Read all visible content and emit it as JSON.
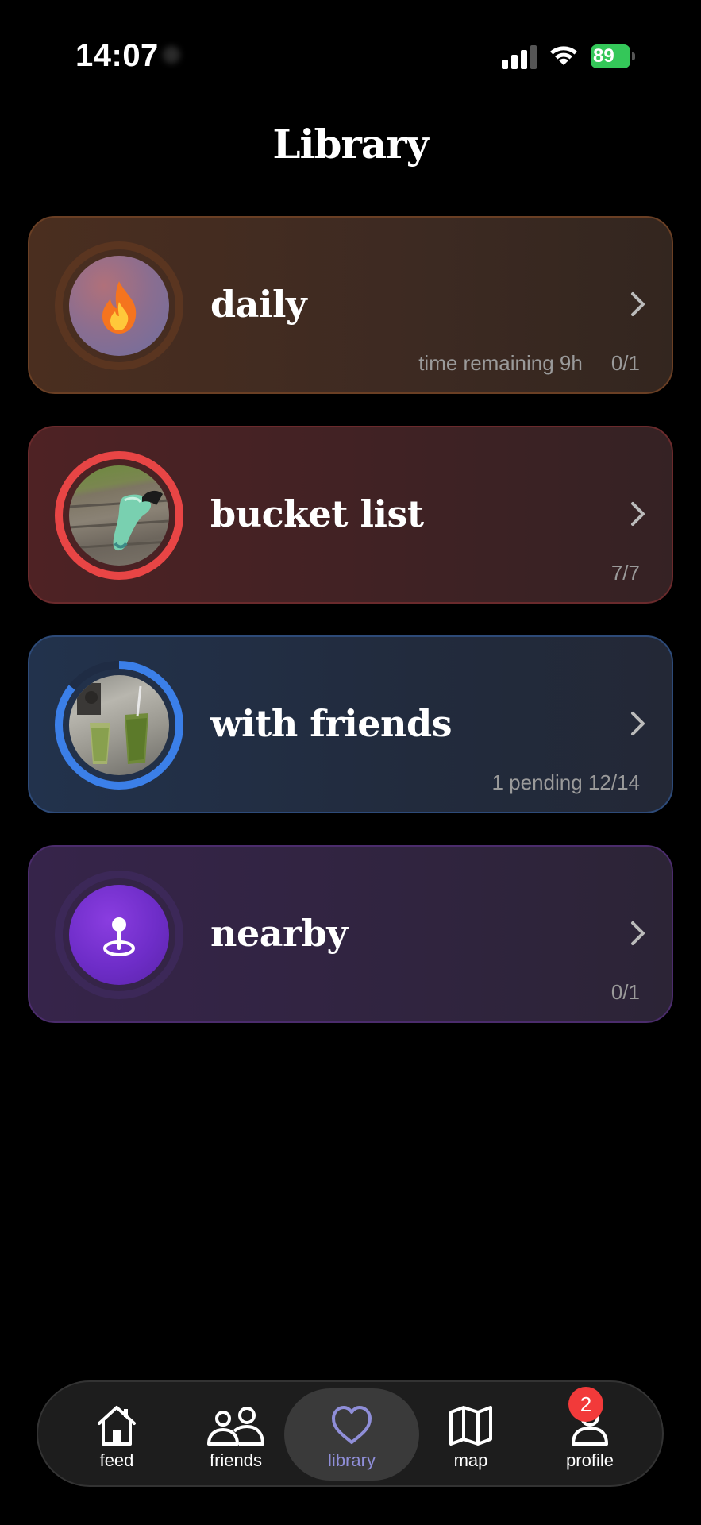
{
  "status_bar": {
    "time": "14:07",
    "battery_level": "89",
    "battery_color": "#34c759",
    "icons": [
      "signal-icon",
      "wifi-icon",
      "battery-charging-icon"
    ]
  },
  "page": {
    "title": "Library"
  },
  "cards": [
    {
      "title": "daily",
      "meta_left": "time remaining 9h",
      "meta_right": "0/1",
      "progress": 0.0,
      "ring_color": "#5a3520",
      "icon": "fire-icon"
    },
    {
      "title": "bucket list",
      "meta_left": "",
      "meta_right": "7/7",
      "progress": 1.0,
      "ring_color": "#e84545",
      "icon": "photo-thumbnail-shoe"
    },
    {
      "title": "with friends",
      "meta_left": "",
      "meta_right": "1 pending 12/14",
      "progress": 0.857,
      "ring_color": "#3b7fe8",
      "icon": "photo-thumbnail-drinks"
    },
    {
      "title": "nearby",
      "meta_left": "",
      "meta_right": "0/1",
      "progress": 0.0,
      "ring_color": "#3c2858",
      "icon": "location-pin-icon"
    }
  ],
  "tabbar": {
    "tabs": [
      {
        "label": "feed",
        "icon": "home-icon"
      },
      {
        "label": "friends",
        "icon": "friends-icon"
      },
      {
        "label": "library",
        "icon": "heart-icon",
        "active": true
      },
      {
        "label": "map",
        "icon": "map-icon"
      },
      {
        "label": "profile",
        "icon": "person-icon"
      }
    ],
    "profile_badge": "2",
    "active_color": "#8f8ed8"
  }
}
